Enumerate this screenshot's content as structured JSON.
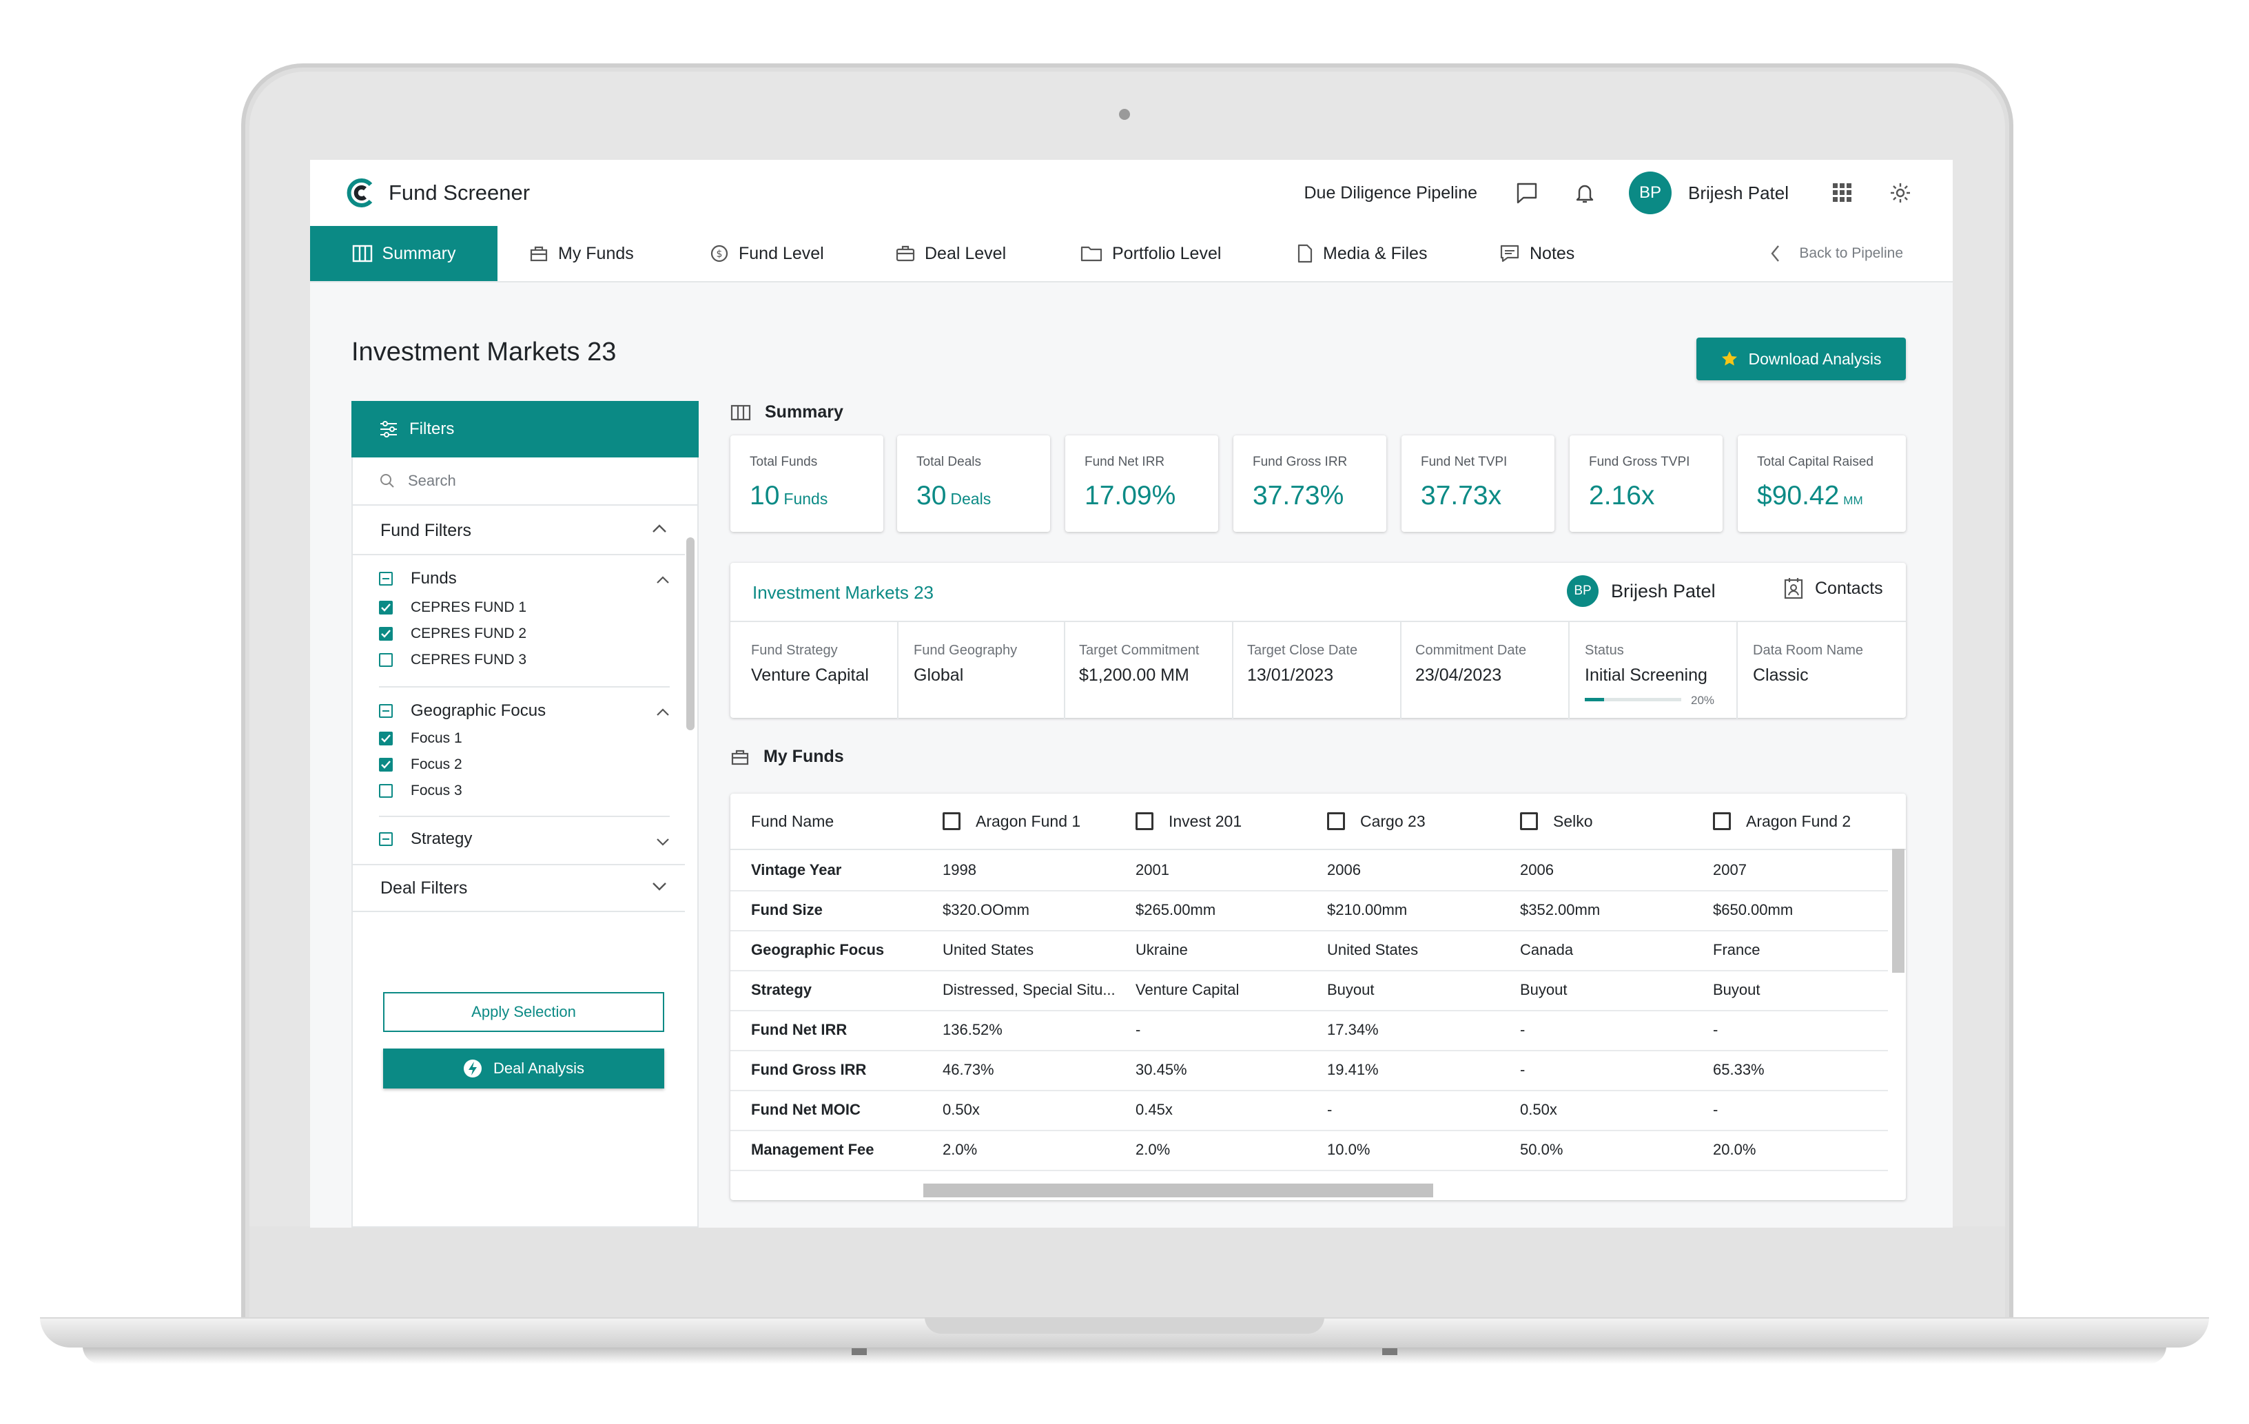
{
  "app": {
    "title": "Fund Screener"
  },
  "topbar": {
    "pipeline_link": "Due Diligence Pipeline",
    "user": {
      "initials": "BP",
      "name": "Brijesh Patel"
    },
    "icons": [
      "chat-icon",
      "bell-icon",
      "apps-grid-icon",
      "gear-icon"
    ]
  },
  "nav": {
    "tabs": [
      {
        "label": "Summary",
        "icon": "columns-icon",
        "active": true
      },
      {
        "label": "My Funds",
        "icon": "briefcase-icon"
      },
      {
        "label": "Fund Level",
        "icon": "dollar-circle-icon"
      },
      {
        "label": "Deal Level",
        "icon": "suitcase-icon"
      },
      {
        "label": "Portfolio Level",
        "icon": "folder-icon"
      },
      {
        "label": "Media & Files",
        "icon": "document-icon"
      },
      {
        "label": "Notes",
        "icon": "notes-icon"
      }
    ],
    "back_label": "Back to Pipeline"
  },
  "page": {
    "title": "Investment Markets 23",
    "download_label": "Download Analysis"
  },
  "filters": {
    "header": "Filters",
    "search_placeholder": "Search",
    "fund_filters_label": "Fund Filters",
    "groups": [
      {
        "label": "Funds",
        "expanded": true,
        "items": [
          {
            "label": "CEPRES FUND 1",
            "checked": true
          },
          {
            "label": "CEPRES FUND 2",
            "checked": true
          },
          {
            "label": "CEPRES FUND 3",
            "checked": false
          }
        ]
      },
      {
        "label": "Geographic Focus",
        "expanded": true,
        "items": [
          {
            "label": "Focus 1",
            "checked": true
          },
          {
            "label": "Focus 2",
            "checked": true
          },
          {
            "label": "Focus 3",
            "checked": false
          }
        ]
      },
      {
        "label": "Strategy",
        "expanded": false,
        "items": []
      }
    ],
    "deal_filters_label": "Deal Filters",
    "apply_label": "Apply Selection",
    "deal_analysis_label": "Deal Analysis"
  },
  "summary": {
    "label": "Summary",
    "cards": [
      {
        "label": "Total Funds",
        "value": "10",
        "unit": "Funds"
      },
      {
        "label": "Total Deals",
        "value": "30",
        "unit": "Deals"
      },
      {
        "label": "Fund Net IRR",
        "value": "17.09%",
        "unit": ""
      },
      {
        "label": "Fund Gross IRR",
        "value": "37.73%",
        "unit": ""
      },
      {
        "label": "Fund Net TVPI",
        "value": "37.73x",
        "unit": ""
      },
      {
        "label": "Fund Gross TVPI",
        "value": "2.16x",
        "unit": ""
      },
      {
        "label": "Total Capital Raised",
        "value": "$90.42",
        "unit": "MM"
      }
    ]
  },
  "deal": {
    "name": "Investment Markets 23",
    "owner": {
      "initials": "BP",
      "name": "Brijesh Patel"
    },
    "contacts_label": "Contacts",
    "fields": [
      {
        "label": "Fund Strategy",
        "value": "Venture Capital"
      },
      {
        "label": "Fund Geography",
        "value": "Global"
      },
      {
        "label": "Target Commitment",
        "value": "$1,200.00 MM"
      },
      {
        "label": "Target Close Date",
        "value": "13/01/2023"
      },
      {
        "label": "Commitment Date",
        "value": "23/04/2023"
      },
      {
        "label": "Status",
        "value": "Initial Screening",
        "progress": 0.2,
        "progress_label": "20%"
      },
      {
        "label": "Data Room Name",
        "value": "Classic"
      }
    ]
  },
  "my_funds": {
    "label": "My Funds",
    "first_column": "Fund Name",
    "columns": [
      "Aragon Fund 1",
      "Invest 201",
      "Cargo 23",
      "Selko",
      "Aragon Fund 2"
    ],
    "rows": [
      {
        "label": "Vintage Year",
        "cells": [
          "1998",
          "2001",
          "2006",
          "2006",
          "2007"
        ]
      },
      {
        "label": "Fund Size",
        "cells": [
          "$320.OOmm",
          "$265.00mm",
          "$210.00mm",
          "$352.00mm",
          "$650.00mm"
        ]
      },
      {
        "label": "Geographic Focus",
        "cells": [
          "United States",
          "Ukraine",
          "United States",
          "Canada",
          "France"
        ]
      },
      {
        "label": "Strategy",
        "cells": [
          "Distressed, Special Situ...",
          "Venture Capital",
          "Buyout",
          "Buyout",
          "Buyout"
        ]
      },
      {
        "label": "Fund Net IRR",
        "cells": [
          "136.52%",
          "-",
          "17.34%",
          "-",
          "-"
        ]
      },
      {
        "label": "Fund Gross IRR",
        "cells": [
          "46.73%",
          "30.45%",
          "19.41%",
          "-",
          "65.33%"
        ]
      },
      {
        "label": "Fund Net MOIC",
        "cells": [
          "0.50x",
          "0.45x",
          "-",
          "0.50x",
          "-"
        ]
      },
      {
        "label": "Management Fee",
        "cells": [
          "2.0%",
          "2.0%",
          "10.0%",
          "50.0%",
          "20.0%"
        ]
      }
    ]
  },
  "colors": {
    "accent": "#0b8a85",
    "star": "#f5c518"
  }
}
